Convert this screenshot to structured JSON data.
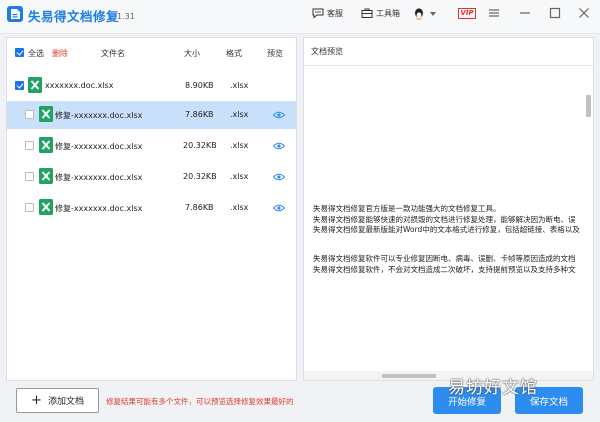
{
  "app": {
    "title": "失易得文档修复",
    "version": "1.31"
  },
  "toolbar": {
    "service_label": "客服",
    "toolbox_label": "工具箱",
    "vip_label": "VIP"
  },
  "table": {
    "select_all_label": "全选",
    "delete_label": "删除",
    "col_name": "文件名",
    "col_size": "大小",
    "col_format": "格式",
    "col_preview": "预览"
  },
  "files": [
    {
      "name": "xxxxxxx.doc.xlsx",
      "size": "8.90KB",
      "format": ".xlsx",
      "checked": true,
      "selected": false,
      "child": false
    },
    {
      "name": "修复-xxxxxxx.doc.xlsx",
      "size": "7.86KB",
      "format": ".xlsx",
      "checked": false,
      "selected": true,
      "child": true
    },
    {
      "name": "修复-xxxxxxx.doc.xlsx",
      "size": "20.32KB",
      "format": ".xlsx",
      "checked": false,
      "selected": false,
      "child": true
    },
    {
      "name": "修复-xxxxxxx.doc.xlsx",
      "size": "20.32KB",
      "format": ".xlsx",
      "checked": false,
      "selected": false,
      "child": true
    },
    {
      "name": "修复-xxxxxxx.doc.xlsx",
      "size": "7.86KB",
      "format": ".xlsx",
      "checked": false,
      "selected": false,
      "child": true
    }
  ],
  "preview": {
    "title": "文档预览",
    "lines": [
      "失易得文档修复官方版是一款功能强大的文档修复工具。",
      "失易得文档修复能够快速的对损毁的文档进行修复处理，能够解决因为断电、误",
      "失易得文档修复最新版能对Word中的文本格式进行修复，包括超链接、表格以及",
      "",
      "失易得文档修复软件可以专业修复因断电、病毒、误删、卡帧等原因造成的文档",
      "失易得文档修复软件，不会对文档造成二次破坏，支持提前预览以及支持多种文"
    ]
  },
  "footer": {
    "add_label": "添加文档",
    "hint": "修复结果可能有多个文件，可以预览选择修复效果最好的",
    "start_label": "开始修复",
    "save_label": "保存文档"
  },
  "watermark": "易坊好文馆",
  "colors": {
    "accent": "#2d8cf0",
    "title": "#1e7ee0",
    "excel": "#21a366",
    "warning": "#e03a2f",
    "selected_row": "#c9e0fb"
  }
}
